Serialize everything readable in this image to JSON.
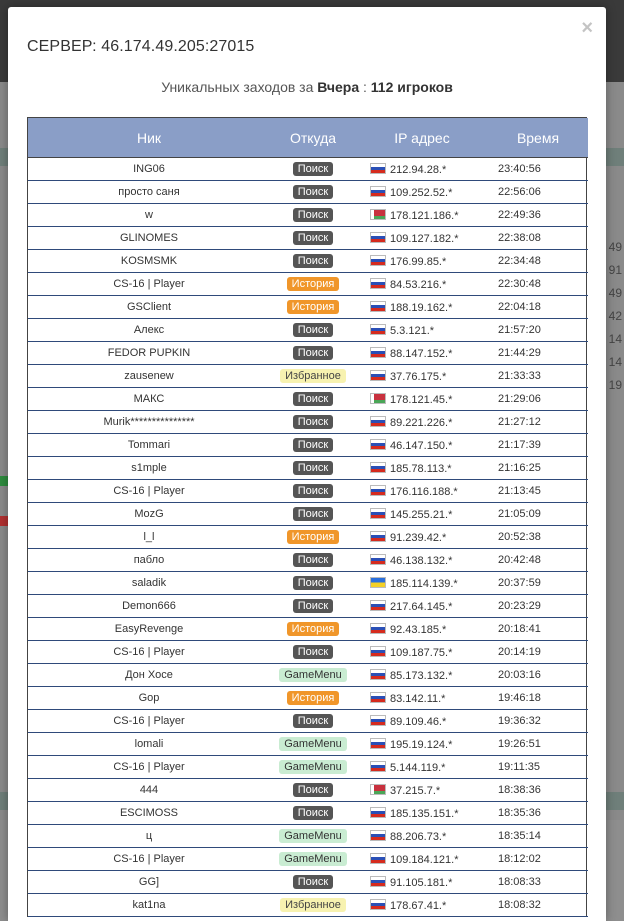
{
  "modal": {
    "title": "СЕРВЕР: 46.174.49.205:27015",
    "close_glyph": "×",
    "summary_prefix": "Уникальных заходов за",
    "summary_period": "Вчера",
    "summary_sep": " : ",
    "summary_count": "112 игроков"
  },
  "table": {
    "headers": [
      "Ник",
      "Откуда",
      "IP адрес",
      "Время"
    ],
    "rows": [
      {
        "nick": "ING06",
        "source": "Поиск",
        "src_type": "search",
        "flag": "ru",
        "ip": "212.94.28.*",
        "time": "23:40:56"
      },
      {
        "nick": "просто саня",
        "source": "Поиск",
        "src_type": "search",
        "flag": "ru",
        "ip": "109.252.52.*",
        "time": "22:56:06"
      },
      {
        "nick": "w",
        "source": "Поиск",
        "src_type": "search",
        "flag": "by",
        "ip": "178.121.186.*",
        "time": "22:49:36"
      },
      {
        "nick": "GLINOMES",
        "source": "Поиск",
        "src_type": "search",
        "flag": "ru",
        "ip": "109.127.182.*",
        "time": "22:38:08"
      },
      {
        "nick": "KOSMSMK",
        "source": "Поиск",
        "src_type": "search",
        "flag": "ru",
        "ip": "176.99.85.*",
        "time": "22:34:48"
      },
      {
        "nick": "CS-16 | Player",
        "source": "История",
        "src_type": "history",
        "flag": "ru",
        "ip": "84.53.216.*",
        "time": "22:30:48"
      },
      {
        "nick": "GSClient",
        "source": "История",
        "src_type": "history",
        "flag": "ru",
        "ip": "188.19.162.*",
        "time": "22:04:18"
      },
      {
        "nick": "Алекс",
        "source": "Поиск",
        "src_type": "search",
        "flag": "ru",
        "ip": "5.3.121.*",
        "time": "21:57:20"
      },
      {
        "nick": "FEDOR PUPKIN",
        "source": "Поиск",
        "src_type": "search",
        "flag": "ru",
        "ip": "88.147.152.*",
        "time": "21:44:29"
      },
      {
        "nick": "zausenew",
        "source": "Избранное",
        "src_type": "fav",
        "flag": "ru",
        "ip": "37.76.175.*",
        "time": "21:33:33"
      },
      {
        "nick": "МАКС",
        "source": "Поиск",
        "src_type": "search",
        "flag": "by",
        "ip": "178.121.45.*",
        "time": "21:29:06"
      },
      {
        "nick": "Murik***************",
        "source": "Поиск",
        "src_type": "search",
        "flag": "ru",
        "ip": "89.221.226.*",
        "time": "21:27:12"
      },
      {
        "nick": "Tommari",
        "source": "Поиск",
        "src_type": "search",
        "flag": "ru",
        "ip": "46.147.150.*",
        "time": "21:17:39"
      },
      {
        "nick": "s1mple",
        "source": "Поиск",
        "src_type": "search",
        "flag": "ru",
        "ip": "185.78.113.*",
        "time": "21:16:25"
      },
      {
        "nick": "CS-16 | Player",
        "source": "Поиск",
        "src_type": "search",
        "flag": "ru",
        "ip": "176.116.188.*",
        "time": "21:13:45"
      },
      {
        "nick": "MozG",
        "source": "Поиск",
        "src_type": "search",
        "flag": "ru",
        "ip": "145.255.21.*",
        "time": "21:05:09"
      },
      {
        "nick": "l_l",
        "source": "История",
        "src_type": "history",
        "flag": "ru",
        "ip": "91.239.42.*",
        "time": "20:52:38"
      },
      {
        "nick": "пабло",
        "source": "Поиск",
        "src_type": "search",
        "flag": "ru",
        "ip": "46.138.132.*",
        "time": "20:42:48"
      },
      {
        "nick": "saladik",
        "source": "Поиск",
        "src_type": "search",
        "flag": "ua",
        "ip": "185.114.139.*",
        "time": "20:37:59"
      },
      {
        "nick": "Demon666",
        "source": "Поиск",
        "src_type": "search",
        "flag": "ru",
        "ip": "217.64.145.*",
        "time": "20:23:29"
      },
      {
        "nick": "EasyRevenge",
        "source": "История",
        "src_type": "history",
        "flag": "ru",
        "ip": "92.43.185.*",
        "time": "20:18:41"
      },
      {
        "nick": "CS-16 | Player",
        "source": "Поиск",
        "src_type": "search",
        "flag": "ru",
        "ip": "109.187.75.*",
        "time": "20:14:19"
      },
      {
        "nick": "Дон Хосе",
        "source": "GameMenu",
        "src_type": "gm",
        "flag": "ru",
        "ip": "85.173.132.*",
        "time": "20:03:16"
      },
      {
        "nick": "Gop",
        "source": "История",
        "src_type": "history",
        "flag": "ru",
        "ip": "83.142.11.*",
        "time": "19:46:18"
      },
      {
        "nick": "CS-16 | Player",
        "source": "Поиск",
        "src_type": "search",
        "flag": "ru",
        "ip": "89.109.46.*",
        "time": "19:36:32"
      },
      {
        "nick": "lomali",
        "source": "GameMenu",
        "src_type": "gm",
        "flag": "ru",
        "ip": "195.19.124.*",
        "time": "19:26:51"
      },
      {
        "nick": "CS-16 | Player",
        "source": "GameMenu",
        "src_type": "gm",
        "flag": "ru",
        "ip": "5.144.119.*",
        "time": "19:11:35"
      },
      {
        "nick": "444",
        "source": "Поиск",
        "src_type": "search",
        "flag": "by",
        "ip": "37.215.7.*",
        "time": "18:38:36"
      },
      {
        "nick": "ESCIMOSS",
        "source": "Поиск",
        "src_type": "search",
        "flag": "ru",
        "ip": "185.135.151.*",
        "time": "18:35:36"
      },
      {
        "nick": "ц",
        "source": "GameMenu",
        "src_type": "gm",
        "flag": "ru",
        "ip": "88.206.73.*",
        "time": "18:35:14"
      },
      {
        "nick": "CS-16 | Player",
        "source": "GameMenu",
        "src_type": "gm",
        "flag": "ru",
        "ip": "109.184.121.*",
        "time": "18:12:02"
      },
      {
        "nick": "GG]",
        "source": "Поиск",
        "src_type": "search",
        "flag": "ru",
        "ip": "91.105.181.*",
        "time": "18:08:33"
      },
      {
        "nick": "kat1na",
        "source": "Избранное",
        "src_type": "fav",
        "flag": "ru",
        "ip": "178.67.41.*",
        "time": "18:08:32"
      }
    ]
  },
  "background": {
    "right_numbers": [
      "49",
      "91",
      "49",
      "42",
      "14",
      "14",
      "19"
    ]
  },
  "colors": {
    "header_bg": "#8a9ec7",
    "badge_search": "#555555",
    "badge_history": "#f0962a",
    "badge_fav": "#f7f2b0",
    "badge_gamemenu": "#c9ecd2"
  }
}
